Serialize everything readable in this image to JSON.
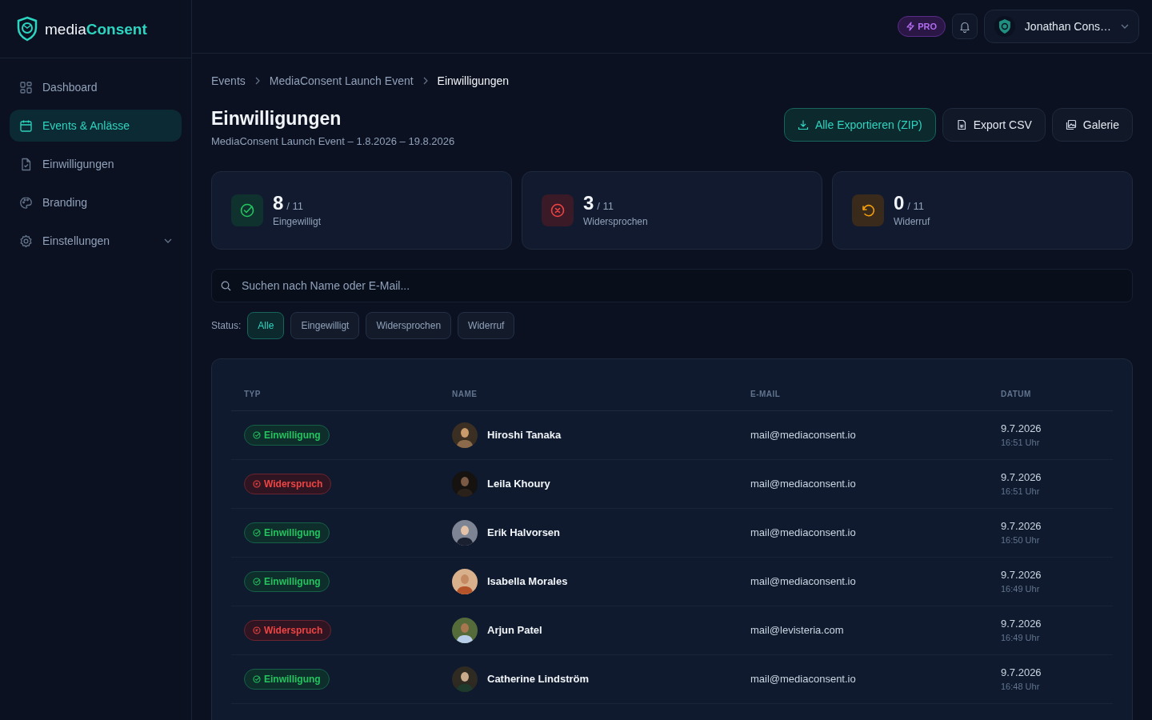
{
  "logo": {
    "prefix": "media",
    "suffix": "Consent"
  },
  "sidebar": {
    "items": [
      {
        "label": "Dashboard",
        "kind": "dashboard",
        "selected": false,
        "has_submenu": false
      },
      {
        "label": "Events & Anlässe",
        "kind": "calendar",
        "selected": true,
        "has_submenu": false
      },
      {
        "label": "Einwilligungen",
        "kind": "document",
        "selected": false,
        "has_submenu": false
      },
      {
        "label": "Branding",
        "kind": "palette",
        "selected": false,
        "has_submenu": false
      },
      {
        "label": "Einstellungen",
        "kind": "settings",
        "selected": false,
        "has_submenu": true
      }
    ]
  },
  "topbar": {
    "plan_badge": "PRO",
    "user_name": "Jonathan Cons…"
  },
  "breadcrumb": [
    {
      "label": "Events",
      "current": false
    },
    {
      "label": "MediaConsent Launch Event",
      "current": false
    },
    {
      "label": "Einwilligungen",
      "current": true
    }
  ],
  "title": "Einwilligungen",
  "subtitle": "MediaConsent Launch Event – 1.8.2026 – 19.8.2026",
  "actions": [
    {
      "label": "Alle Exportieren (ZIP)",
      "kind": "download",
      "primary": true
    },
    {
      "label": "Export CSV",
      "kind": "csv",
      "primary": false
    },
    {
      "label": "Galerie",
      "kind": "gallery",
      "primary": false
    }
  ],
  "stats": [
    {
      "value": "8",
      "total": "/ 11",
      "label": "Eingewilligt",
      "kind": "consent"
    },
    {
      "value": "3",
      "total": "/ 11",
      "label": "Widersprochen",
      "kind": "objection"
    },
    {
      "value": "0",
      "total": "/ 11",
      "label": "Widerruf",
      "kind": "revocation"
    }
  ],
  "search": {
    "placeholder": "Suchen nach Name oder E-Mail..."
  },
  "filter": {
    "label": "Status:",
    "chips": [
      {
        "label": "Alle",
        "selected": true
      },
      {
        "label": "Eingewilligt",
        "selected": false
      },
      {
        "label": "Widersprochen",
        "selected": false
      },
      {
        "label": "Widerruf",
        "selected": false
      }
    ]
  },
  "table": {
    "columns": [
      "TYP",
      "NAME",
      "E-MAIL",
      "DATUM"
    ],
    "rows": [
      {
        "type": {
          "label": "Einwilligung",
          "kind": "consent"
        },
        "name": "Hiroshi Tanaka",
        "email": "mail@mediaconsent.io",
        "date": "9.7.2026",
        "time": "16:51 Uhr"
      },
      {
        "type": {
          "label": "Widerspruch",
          "kind": "objection"
        },
        "name": "Leila Khoury",
        "email": "mail@mediaconsent.io",
        "date": "9.7.2026",
        "time": "16:51 Uhr"
      },
      {
        "type": {
          "label": "Einwilligung",
          "kind": "consent"
        },
        "name": "Erik Halvorsen",
        "email": "mail@mediaconsent.io",
        "date": "9.7.2026",
        "time": "16:50 Uhr"
      },
      {
        "type": {
          "label": "Einwilligung",
          "kind": "consent"
        },
        "name": "Isabella Morales",
        "email": "mail@mediaconsent.io",
        "date": "9.7.2026",
        "time": "16:49 Uhr"
      },
      {
        "type": {
          "label": "Widerspruch",
          "kind": "objection"
        },
        "name": "Arjun Patel",
        "email": "mail@levisteria.com",
        "date": "9.7.2026",
        "time": "16:49 Uhr"
      },
      {
        "type": {
          "label": "Einwilligung",
          "kind": "consent"
        },
        "name": "Catherine Lindström",
        "email": "mail@mediaconsent.io",
        "date": "9.7.2026",
        "time": "16:48 Uhr"
      }
    ]
  }
}
